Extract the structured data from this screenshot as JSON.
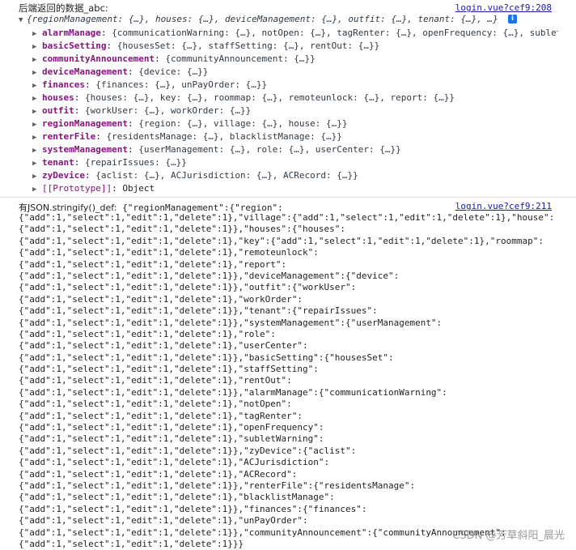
{
  "log1": {
    "label": "后端返回的数据_abc:",
    "source": "login.vue?cef9:208",
    "summary": "{regionManagement: {…}, houses: {…}, deviceManagement: {…}, outfit: {…}, tenant: {…}, …}",
    "info_icon": "info-icon",
    "properties": [
      {
        "key": "alarmManage",
        "value": "{communicationWarning: {…}, notOpen: {…}, tagRenter: {…}, openFrequency: {…}, subletWarning: {…}}"
      },
      {
        "key": "basicSetting",
        "value": "{housesSet: {…}, staffSetting: {…}, rentOut: {…}}"
      },
      {
        "key": "communityAnnouncement",
        "value": "{communityAnnouncement: {…}}"
      },
      {
        "key": "deviceManagement",
        "value": "{device: {…}}"
      },
      {
        "key": "finances",
        "value": "{finances: {…}, unPayOrder: {…}}"
      },
      {
        "key": "houses",
        "value": "{houses: {…}, key: {…}, roommap: {…}, remoteunlock: {…}, report: {…}}"
      },
      {
        "key": "outfit",
        "value": "{workUser: {…}, workOrder: {…}}"
      },
      {
        "key": "regionManagement",
        "value": "{region: {…}, village: {…}, house: {…}}"
      },
      {
        "key": "renterFile",
        "value": "{residentsManage: {…}, blacklistManage: {…}}"
      },
      {
        "key": "systemManagement",
        "value": "{userManagement: {…}, role: {…}, userCenter: {…}}"
      },
      {
        "key": "tenant",
        "value": "{repairIssues: {…}}"
      },
      {
        "key": "zyDevice",
        "value": "{aclist: {…}, ACJurisdiction: {…}, ACRecord: {…}}"
      }
    ],
    "prototype_key": "[[Prototype]]",
    "prototype_value": "Object"
  },
  "log2": {
    "label": "有JSON.stringify()_def:",
    "source": "login.vue?cef9:211",
    "first_line": "{\"regionManagement\":{\"region\":",
    "lines": [
      "{\"add\":1,\"select\":1,\"edit\":1,\"delete\":1},\"village\":{\"add\":1,\"select\":1,\"edit\":1,\"delete\":1},\"house\":",
      "{\"add\":1,\"select\":1,\"edit\":1,\"delete\":1}},\"houses\":{\"houses\":",
      "{\"add\":1,\"select\":1,\"edit\":1,\"delete\":1},\"key\":{\"add\":1,\"select\":1,\"edit\":1,\"delete\":1},\"roommap\":",
      "{\"add\":1,\"select\":1,\"edit\":1,\"delete\":1},\"remoteunlock\":",
      "{\"add\":1,\"select\":1,\"edit\":1,\"delete\":1},\"report\":",
      "{\"add\":1,\"select\":1,\"edit\":1,\"delete\":1}},\"deviceManagement\":{\"device\":",
      "{\"add\":1,\"select\":1,\"edit\":1,\"delete\":1}},\"outfit\":{\"workUser\":",
      "{\"add\":1,\"select\":1,\"edit\":1,\"delete\":1},\"workOrder\":",
      "{\"add\":1,\"select\":1,\"edit\":1,\"delete\":1}},\"tenant\":{\"repairIssues\":",
      "{\"add\":1,\"select\":1,\"edit\":1,\"delete\":1}},\"systemManagement\":{\"userManagement\":",
      "{\"add\":1,\"select\":1,\"edit\":1,\"delete\":1},\"role\":",
      "{\"add\":1,\"select\":1,\"edit\":1,\"delete\":1},\"userCenter\":",
      "{\"add\":1,\"select\":1,\"edit\":1,\"delete\":1}},\"basicSetting\":{\"housesSet\":",
      "{\"add\":1,\"select\":1,\"edit\":1,\"delete\":1},\"staffSetting\":",
      "{\"add\":1,\"select\":1,\"edit\":1,\"delete\":1},\"rentOut\":",
      "{\"add\":1,\"select\":1,\"edit\":1,\"delete\":1}},\"alarmManage\":{\"communicationWarning\":",
      "{\"add\":1,\"select\":1,\"edit\":1,\"delete\":1},\"notOpen\":",
      "{\"add\":1,\"select\":1,\"edit\":1,\"delete\":1},\"tagRenter\":",
      "{\"add\":1,\"select\":1,\"edit\":1,\"delete\":1},\"openFrequency\":",
      "{\"add\":1,\"select\":1,\"edit\":1,\"delete\":1},\"subletWarning\":",
      "{\"add\":1,\"select\":1,\"edit\":1,\"delete\":1}},\"zyDevice\":{\"aclist\":",
      "{\"add\":1,\"select\":1,\"edit\":1,\"delete\":1},\"ACJurisdiction\":",
      "{\"add\":1,\"select\":1,\"edit\":1,\"delete\":1},\"ACRecord\":",
      "{\"add\":1,\"select\":1,\"edit\":1,\"delete\":1}},\"renterFile\":{\"residentsManage\":",
      "{\"add\":1,\"select\":1,\"edit\":1,\"delete\":1},\"blacklistManage\":",
      "{\"add\":1,\"select\":1,\"edit\":1,\"delete\":1}},\"finances\":{\"finances\":",
      "{\"add\":1,\"select\":1,\"edit\":1,\"delete\":1},\"unPayOrder\":",
      "{\"add\":1,\"select\":1,\"edit\":1,\"delete\":1}},\"communityAnnouncement\":{\"communityAnnouncement\":",
      "{\"add\":1,\"select\":1,\"edit\":1,\"delete\":1}}}"
    ]
  },
  "watermark": "CSDN @芳草斜阳_晨光",
  "colors": {
    "key": "#881280",
    "link": "#1a1aa6",
    "info_badge": "#1a73e8"
  }
}
